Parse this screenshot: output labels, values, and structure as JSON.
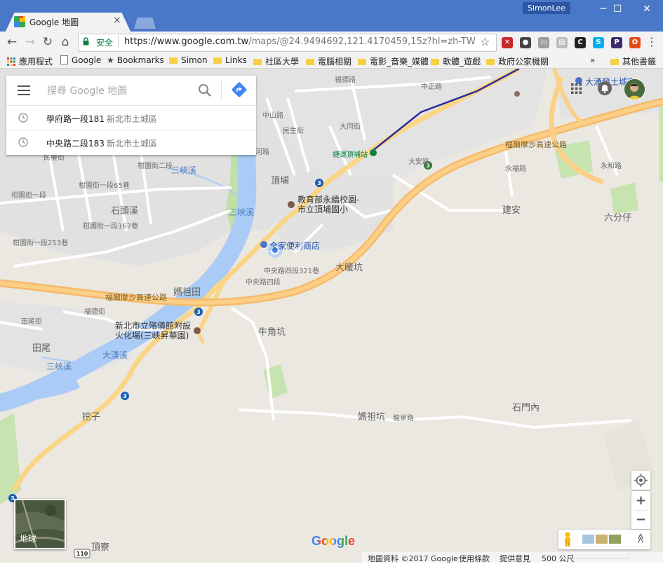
{
  "browser": {
    "tab_title": "Google 地圖",
    "user_name": "SimonLee",
    "secure_label": "安全",
    "url_host": "https://www.google.com.tw",
    "url_path": "/maps/@24.9494692,121.4170459,15z?hl=zh-TW",
    "extensions": [
      {
        "icon": "muted-camera-icon",
        "color": "#c62828",
        "glyph": "✕"
      },
      {
        "icon": "film-reel-icon",
        "color": "#444444",
        "glyph": "●"
      },
      {
        "icon": "window-icon",
        "color": "#9e9e9e",
        "glyph": "▭"
      },
      {
        "icon": "wallet-icon",
        "color": "#bdbdbd",
        "glyph": "▤"
      },
      {
        "icon": "moon-icon",
        "color": "#222222",
        "glyph": "C"
      },
      {
        "icon": "skype-icon",
        "color": "#00aff0",
        "glyph": "S"
      },
      {
        "icon": "pocket-p-icon",
        "color": "#3d2b6b",
        "glyph": "P"
      },
      {
        "icon": "office-icon",
        "color": "#e64a19",
        "glyph": "O"
      }
    ]
  },
  "bookmarks": {
    "apps": "應用程式",
    "items": [
      "Google",
      "Bookmarks",
      "Simon",
      "Links",
      "社區大學",
      "電腦相關",
      "電影_音樂_媒體",
      "軟體_遊戲",
      "政府公家機關"
    ],
    "more": "»",
    "other": "其他書籤"
  },
  "search": {
    "placeholder": "搜尋 Google 地圖",
    "suggestions": [
      {
        "main": "學府路一段181",
        "sub": "新北市土城區"
      },
      {
        "main": "中央路二段183",
        "sub": "新北市土城區"
      }
    ]
  },
  "map": {
    "areas": [
      "頂埔",
      "石頭溪",
      "媽祖田",
      "大暖坑",
      "牛角坑",
      "建安",
      "六分仔",
      "田尾",
      "挖子",
      "媽祖坑",
      "石門內",
      "頂寮"
    ],
    "streets": [
      "中山路",
      "民生街",
      "大同街",
      "中正路",
      "福德路",
      "頂河路",
      "民權街",
      "柑園街一段",
      "柑園街一段65巷",
      "柑園街二段",
      "柑園街一段167巷",
      "柑園街一段253巷",
      "中央路四段321巷",
      "中央路四段",
      "福德街",
      "田尾街",
      "龍泉路",
      "大安路",
      "永和路",
      "永福路"
    ],
    "highways": [
      "福爾摩沙高速公路",
      "福爾摩沙高速公路",
      "3",
      "3",
      "3",
      "3",
      "3",
      "110"
    ],
    "water": [
      "三峽溪",
      "三峽溪",
      "三峽溪",
      "大漢溪"
    ],
    "pois": [
      "捷運頂埔站",
      "教育部永續校園-市立頂埔國小",
      "全家便利商店",
      "新北市立殯儀館附設火化場(三峽昇華園)",
      "大湧發土城店"
    ]
  },
  "controls": {
    "earth_label": "地球",
    "zoom_in": "+",
    "zoom_out": "−",
    "expand": "≫"
  },
  "footer": {
    "map_data": "地圖資料 ©2017 Google",
    "terms": "使用條款",
    "feedback": "提供意見",
    "scale": "500 公尺"
  },
  "google_logo": "Google"
}
